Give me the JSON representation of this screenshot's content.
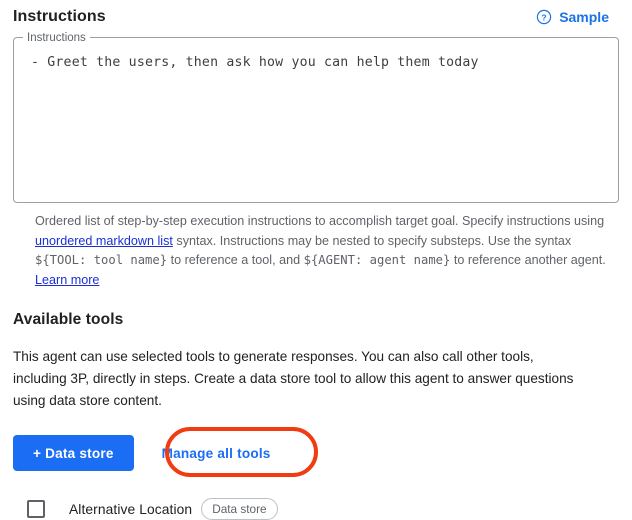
{
  "section": {
    "title": "Instructions",
    "sample_label": "Sample",
    "help_icon": "help-circle-icon"
  },
  "instructions_field": {
    "label": "Instructions",
    "value": "- Greet the users, then ask how you can help them today",
    "placeholder": ""
  },
  "helper": {
    "part1": "Ordered list of step-by-step execution instructions to accomplish target goal. Specify instructions using ",
    "link1": "unordered markdown list",
    "part2": " syntax. Instructions may be nested to specify substeps. Use the syntax ",
    "code1": "${TOOL: tool name}",
    "part3": " to reference a tool, and ",
    "code2": "${AGENT: agent name}",
    "part4": " to reference another agent. ",
    "link2": "Learn more"
  },
  "tools": {
    "heading": "Available tools",
    "description": "This agent can use selected tools to generate responses. You can also call other tools, including 3P, directly in steps. Create a data store tool to allow this agent to answer questions using data store content.",
    "add_data_store_label": "+ Data store",
    "manage_all_tools_label": "Manage all tools"
  },
  "tool_list": [
    {
      "name": "Alternative Location",
      "chip": "Data store",
      "checked": false
    }
  ],
  "colors": {
    "accent_blue": "#1b6ef3",
    "link_blue": "#1a73e8",
    "visited_link": "#1a2fd6",
    "annotation_red": "#f03c10",
    "text_primary": "#202124",
    "text_secondary": "#5f6368",
    "border_gray": "#9aa0a6"
  }
}
